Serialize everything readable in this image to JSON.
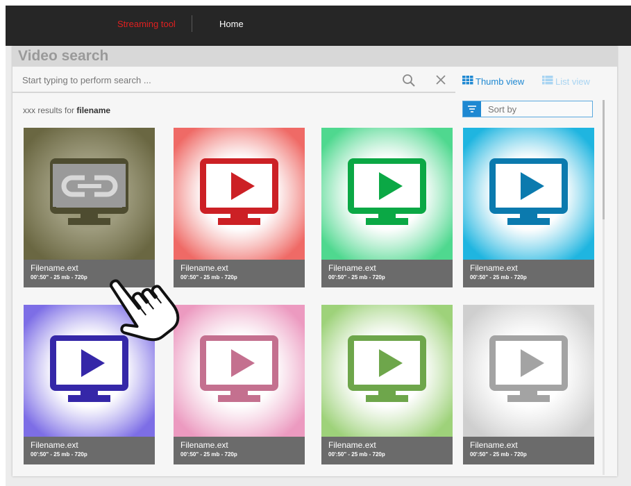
{
  "topbar": {
    "brand": "Streaming tool",
    "nav_home": "Home"
  },
  "panel": {
    "title": "Video search"
  },
  "search": {
    "placeholder": "Start typing to perform search ..."
  },
  "views": {
    "thumb_label": "Thumb view",
    "list_label": "List view",
    "active": "thumb"
  },
  "results": {
    "count_text": "xxx results for",
    "query": "filename"
  },
  "sort": {
    "label": "Sort by"
  },
  "tiles": [
    {
      "name": "Filename.ext",
      "meta": "00':50\" - 25 mb - 720p",
      "type": "link",
      "bg": "#6a6742",
      "glow": "#8e8b68",
      "fg": "#4e4c30"
    },
    {
      "name": "Filename.ext",
      "meta": "00':50\" - 25 mb - 720p",
      "type": "play",
      "bg": "#ef6a66",
      "glow": "#ffffff",
      "fg": "#cc2025"
    },
    {
      "name": "Filename.ext",
      "meta": "00':50\" - 25 mb - 720p",
      "type": "play",
      "bg": "#4fd88f",
      "glow": "#ffffff",
      "fg": "#0ba845"
    },
    {
      "name": "Filename.ext",
      "meta": "00':50\" - 25 mb - 720p",
      "type": "play",
      "bg": "#1fb5e0",
      "glow": "#ffffff",
      "fg": "#0b7aae"
    },
    {
      "name": "Filename.ext",
      "meta": "00':50\" - 25 mb - 720p",
      "type": "play",
      "bg": "#7d6ee6",
      "glow": "#ffffff",
      "fg": "#3527a8"
    },
    {
      "name": "Filename.ext",
      "meta": "00':50\" - 25 mb - 720p",
      "type": "play",
      "bg": "#ec9ac0",
      "glow": "#ffffff",
      "fg": "#c4708f"
    },
    {
      "name": "Filename.ext",
      "meta": "00':50\" - 25 mb - 720p",
      "type": "play",
      "bg": "#9ed27a",
      "glow": "#ffffff",
      "fg": "#6ea64b"
    },
    {
      "name": "Filename.ext",
      "meta": "00':50\" - 25 mb - 720p",
      "type": "play",
      "bg": "#cfcfcf",
      "glow": "#ffffff",
      "fg": "#a3a3a3"
    }
  ],
  "icons": {
    "search": "magnifier-icon",
    "clear": "close-icon",
    "thumb_view": "grid-icon",
    "list_view": "list-icon",
    "sort": "filter-icon",
    "cursor": "hand-pointer-icon"
  }
}
